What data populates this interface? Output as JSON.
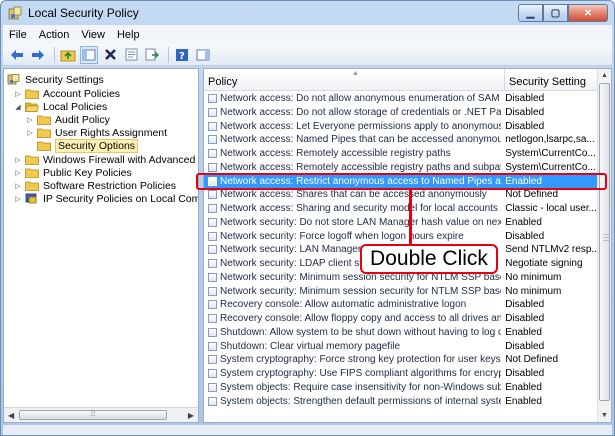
{
  "window": {
    "title": "Local Security Policy"
  },
  "menu": [
    "File",
    "Action",
    "View",
    "Help"
  ],
  "tree": {
    "items": [
      {
        "label": "Security Settings",
        "indent": 0,
        "twisty": "open"
      },
      {
        "label": "Account Policies",
        "indent": 1,
        "twisty": "closed"
      },
      {
        "label": "Local Policies",
        "indent": 1,
        "twisty": "open"
      },
      {
        "label": "Audit Policy",
        "indent": 2,
        "twisty": "closed"
      },
      {
        "label": "User Rights Assignment",
        "indent": 2,
        "twisty": "closed"
      },
      {
        "label": "Security Options",
        "indent": 2,
        "twisty": "",
        "selected": true
      },
      {
        "label": "Windows Firewall with Advanced Sec",
        "indent": 1,
        "twisty": "closed"
      },
      {
        "label": "Public Key Policies",
        "indent": 1,
        "twisty": "closed"
      },
      {
        "label": "Software Restriction Policies",
        "indent": 1,
        "twisty": "closed"
      },
      {
        "label": "IP Security Policies on Local Compute",
        "indent": 1,
        "twisty": "closed",
        "special_icon": true
      }
    ]
  },
  "list": {
    "col_policy": "Policy",
    "col_setting": "Security Setting",
    "rows": [
      {
        "policy": "Network access: Do not allow anonymous enumeration of SAM acco...",
        "setting": "Disabled"
      },
      {
        "policy": "Network access: Do not allow storage of credentials or .NET Passport...",
        "setting": "Disabled"
      },
      {
        "policy": "Network access: Let Everyone permissions apply to anonymous users",
        "setting": "Disabled"
      },
      {
        "policy": "Network access: Named Pipes that can be accessed anonymously",
        "setting": "netlogon,lsarpc,sa..."
      },
      {
        "policy": "Network access: Remotely accessible registry paths",
        "setting": "System\\CurrentCo..."
      },
      {
        "policy": "Network access: Remotely accessible registry paths and subpaths",
        "setting": "System\\CurrentCo..."
      },
      {
        "policy": "Network access: Restrict anonymous access to Named Pipes and Sha...",
        "setting": "Enabled",
        "selected": true
      },
      {
        "policy": "Network access: Shares that can be accessed anonymously",
        "setting": "Not Defined"
      },
      {
        "policy": "Network access: Sharing and security model for local accounts",
        "setting": "Classic - local user..."
      },
      {
        "policy": "Network security: Do not store LAN Manager hash value on next pass",
        "setting": "Enabled"
      },
      {
        "policy": "Network security: Force logoff when logon hours expire",
        "setting": "Disabled"
      },
      {
        "policy": "Network security: LAN Manager authentication level",
        "setting": "Send NTLMv2 resp..."
      },
      {
        "policy": "Network security: LDAP client signing requirements",
        "setting": "Negotiate signing"
      },
      {
        "policy": "Network security: Minimum session security for NTLM SSP based (in...",
        "setting": "No minimum"
      },
      {
        "policy": "Network security: Minimum session security for NTLM SSP based (in...",
        "setting": "No minimum"
      },
      {
        "policy": "Recovery console: Allow automatic administrative logon",
        "setting": "Disabled"
      },
      {
        "policy": "Recovery console: Allow floppy copy and access to all drives and all f...",
        "setting": "Disabled"
      },
      {
        "policy": "Shutdown: Allow system to be shut down without having to log on",
        "setting": "Enabled"
      },
      {
        "policy": "Shutdown: Clear virtual memory pagefile",
        "setting": "Disabled"
      },
      {
        "policy": "System cryptography: Force strong key protection for user keys store...",
        "setting": "Not Defined"
      },
      {
        "policy": "System cryptography: Use FIPS compliant algorithms for encryption, ...",
        "setting": "Disabled"
      },
      {
        "policy": "System objects: Require case insensitivity for non-Windows subsyste...",
        "setting": "Enabled"
      },
      {
        "policy": "System objects: Strengthen default permissions of internal system ob...",
        "setting": "Enabled"
      }
    ]
  },
  "annotation": {
    "callout": "Double Click"
  },
  "colors": {
    "selection": "#3399ff",
    "annotation": "#e60012"
  }
}
